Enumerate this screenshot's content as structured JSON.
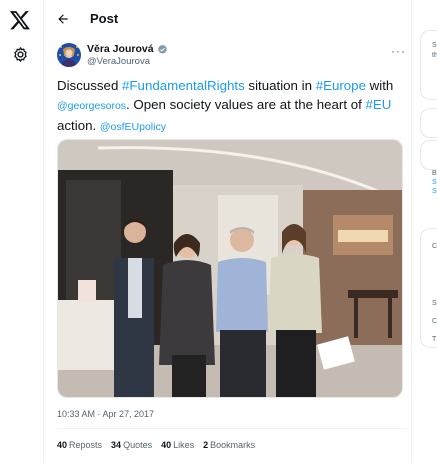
{
  "nav": {
    "logo_icon": "x-logo-icon",
    "settings_icon": "gear-icon"
  },
  "header": {
    "title": "Post",
    "back_icon": "back-arrow-icon"
  },
  "author": {
    "name": "Věra Jourová",
    "handle": "@VeraJourova",
    "verified": true
  },
  "tweet": {
    "parts": [
      {
        "text": "Discussed ",
        "kind": "text"
      },
      {
        "text": "#FundamentalRights",
        "kind": "tag"
      },
      {
        "text": " situation in ",
        "kind": "text"
      },
      {
        "text": "#Europe",
        "kind": "tag"
      },
      {
        "text": " with ",
        "kind": "text"
      },
      {
        "text": "@georgesoros",
        "kind": "mention"
      },
      {
        "text": ". Open society values are at the heart of ",
        "kind": "text"
      },
      {
        "text": "#EU",
        "kind": "tag"
      },
      {
        "text": " action. ",
        "kind": "text"
      },
      {
        "text": "@osfEUpolicy",
        "kind": "mention"
      }
    ],
    "timestamp": "10:33 AM · Apr 27, 2017"
  },
  "stats": [
    {
      "count": "40",
      "label": "Reposts"
    },
    {
      "count": "34",
      "label": "Quotes"
    },
    {
      "count": "40",
      "label": "Likes"
    },
    {
      "count": "2",
      "label": "Bookmarks"
    }
  ],
  "sidebar_fragments": [
    "S",
    "th",
    "B",
    "S",
    "S",
    "C",
    "S",
    "C",
    "T"
  ],
  "colors": {
    "accent": "#1d9bf0",
    "text": "#0f1419",
    "muted": "#536471"
  }
}
